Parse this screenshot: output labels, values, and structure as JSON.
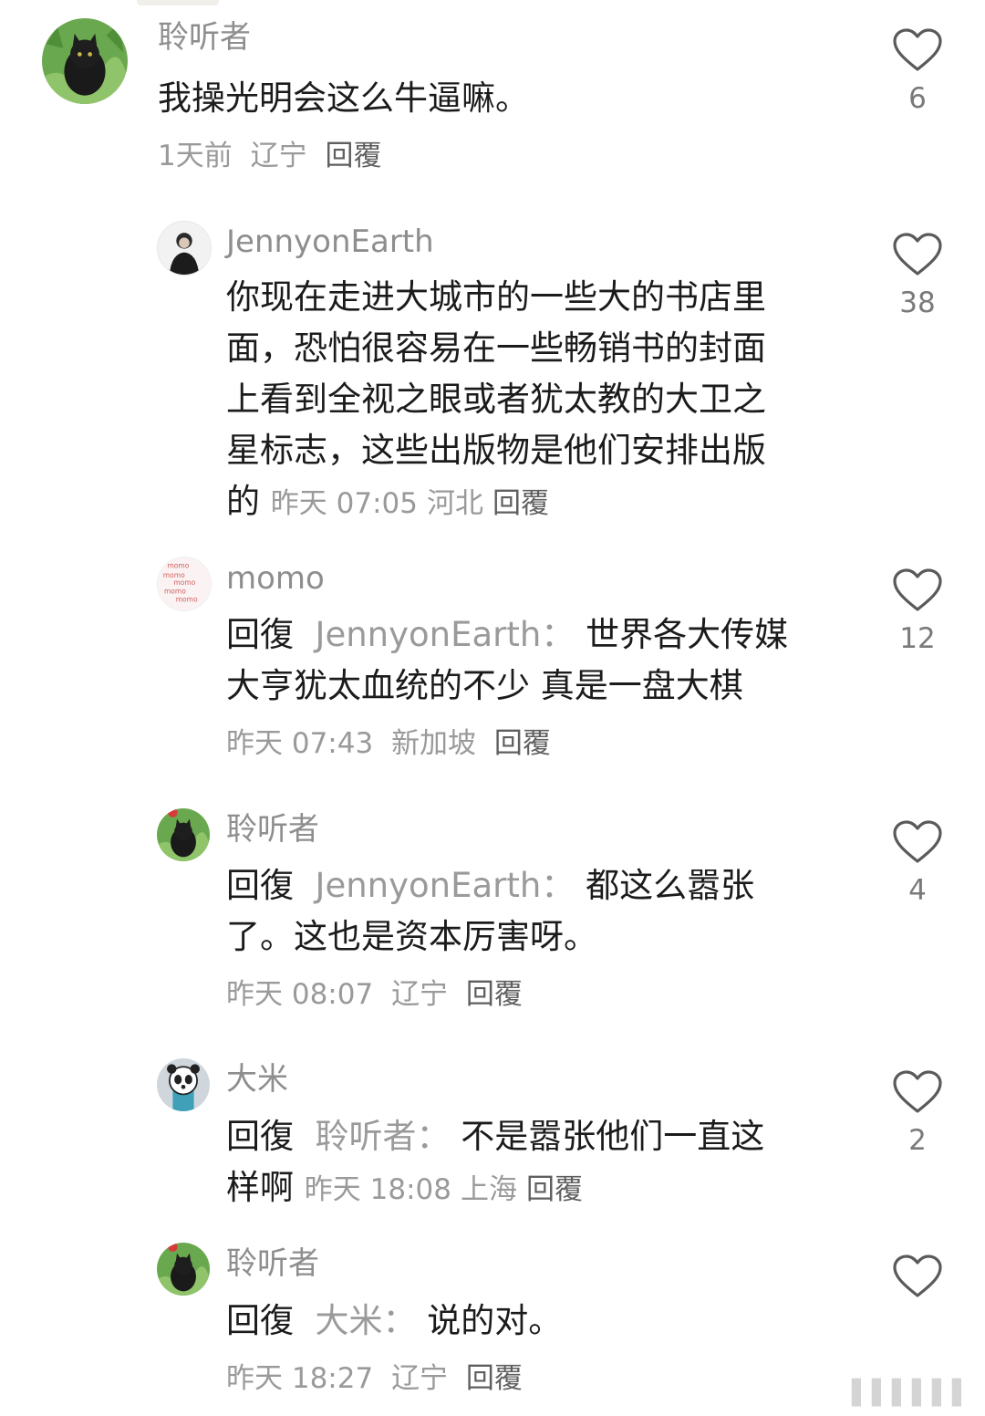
{
  "comments": [
    {
      "user": "聆听者",
      "text": "我操光明会这么牛逼嘛。",
      "time": "1天前",
      "location": "辽宁",
      "reply_label": "回覆",
      "likes": "6"
    },
    {
      "user": "JennyonEarth",
      "text_lines": [
        "你现在走进大城市的一些大的书店里",
        "面，恐怕很容易在一些畅销书的封面",
        "上看到全视之眼或者犹太教的大卫之",
        "星标志，这些出版物是他们安排出版",
        "的"
      ],
      "time": "昨天 07:05",
      "location": "河北",
      "reply_label": "回覆",
      "likes": "38"
    },
    {
      "user": "momo",
      "reply_word": "回復",
      "reply_to": "JennyonEarth：",
      "text_lines": [
        "世界各大传媒",
        "大亨犹太血统的不少 真是一盘大棋"
      ],
      "time": "昨天 07:43",
      "location": "新加坡",
      "reply_label": "回覆",
      "likes": "12"
    },
    {
      "user": "聆听者",
      "reply_word": "回復",
      "reply_to": "JennyonEarth：",
      "text_lines": [
        "都这么嚣张",
        "了。这也是资本厉害呀。"
      ],
      "time": "昨天 08:07",
      "location": "辽宁",
      "reply_label": "回覆",
      "likes": "4"
    },
    {
      "user": "大米",
      "reply_word": "回復",
      "reply_to": "聆听者：",
      "text_lines": [
        "不是嚣张他们一直这",
        "样啊"
      ],
      "time": "昨天 18:08",
      "location": "上海",
      "reply_label": "回覆",
      "likes": "2"
    },
    {
      "user": "聆听者",
      "reply_word": "回復",
      "reply_to": "大米：",
      "text_lines": [
        "说的对。"
      ],
      "time": "昨天 18:27",
      "location": "辽宁",
      "reply_label": "回覆",
      "likes": ""
    }
  ],
  "colors": {
    "username": "#8e8e8e",
    "text": "#1b1b1b",
    "meta": "#9a9a9a",
    "icon": "#5a5a5a"
  },
  "icons": {
    "like": "heart-outline-icon"
  }
}
